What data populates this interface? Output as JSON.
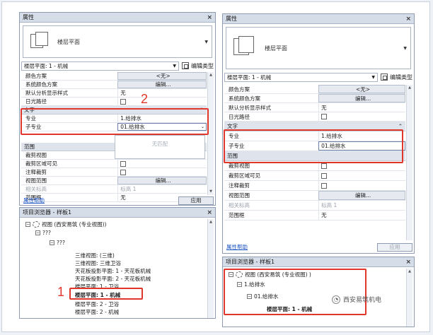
{
  "left": {
    "properties": {
      "title": "属性",
      "close": "×",
      "type_name": "楼层平面",
      "selector": "楼层平面: 1 - 机械",
      "edit_type": "编辑类型",
      "rows_top": [
        {
          "label": "颜色方案",
          "value": "<无>",
          "kind": "btn"
        },
        {
          "label": "系统颜色方案",
          "value": "编辑...",
          "kind": "btn"
        },
        {
          "label": "默认分析显示样式",
          "value": "无",
          "kind": "text"
        },
        {
          "label": "日光路径",
          "value": "",
          "kind": "check"
        }
      ],
      "group_text": "文字",
      "rows_text": [
        {
          "label": "专业",
          "value": "1.给排水"
        },
        {
          "label": "子专业",
          "value": "01.给排水"
        }
      ],
      "dropdown_text": "无匹配",
      "group_range": "范围",
      "rows_range": [
        {
          "label": "裁剪视图",
          "value": ""
        },
        {
          "label": "裁剪区域可见",
          "value": ""
        },
        {
          "label": "注释裁剪",
          "value": ""
        },
        {
          "label": "视图范围",
          "value": "编辑..."
        },
        {
          "label": "相关标高",
          "value": "标高 1"
        },
        {
          "label": "范围框",
          "value": "无"
        }
      ],
      "help": "属性帮助",
      "apply": "应用"
    },
    "browser": {
      "title": "项目浏览器 - 样板1",
      "close": "×",
      "root": "视图 (西安易筑 (专业视图))",
      "q1": "???",
      "q2": "???",
      "items": [
        "三维视图: (三维)",
        "三维视图: 三维卫浴",
        "天花板投影平面: 1 - 天花板机械",
        "天花板投影平面: 2 - 天花板机械",
        "楼层平面: 1 - 卫浴",
        "楼层平面: 1 - 机械",
        "楼层平面: 2 - 卫浴",
        "楼层平面: 2 - 机械"
      ]
    },
    "annot": {
      "n1": "1",
      "n2": "2"
    }
  },
  "right": {
    "properties": {
      "title": "属性",
      "close": "×",
      "type_name": "楼层平面",
      "selector": "楼层平面: 1 - 机械",
      "edit_type": "编辑类型",
      "rows_top": [
        {
          "label": "颜色方案",
          "value": "<无>",
          "kind": "btn"
        },
        {
          "label": "系统颜色方案",
          "value": "编辑...",
          "kind": "btn"
        },
        {
          "label": "默认分析显示样式",
          "value": "无",
          "kind": "text"
        },
        {
          "label": "日光路径",
          "value": "",
          "kind": "check"
        }
      ],
      "group_text": "文字",
      "rows_text": [
        {
          "label": "专业",
          "value": "1.给排水"
        },
        {
          "label": "子专业",
          "value": "01.给排水"
        }
      ],
      "group_range": "范围",
      "rows_range": [
        {
          "label": "裁剪视图",
          "value": ""
        },
        {
          "label": "裁剪区域可见",
          "value": ""
        },
        {
          "label": "注释裁剪",
          "value": ""
        },
        {
          "label": "视图范围",
          "value": "编辑..."
        },
        {
          "label": "相关标高",
          "value": "标高 1"
        },
        {
          "label": "范围框",
          "value": "无"
        }
      ],
      "help": "属性帮助",
      "apply": "应用"
    },
    "browser": {
      "title": "项目浏览器 - 样板1",
      "close": "×",
      "root": "视图 (西安易筑 (专业视图) )",
      "l1": "1.给排水",
      "l2": "01.给排水",
      "l3": "楼层平面: 1 - 机械"
    },
    "watermark": "西安易筑机电"
  }
}
